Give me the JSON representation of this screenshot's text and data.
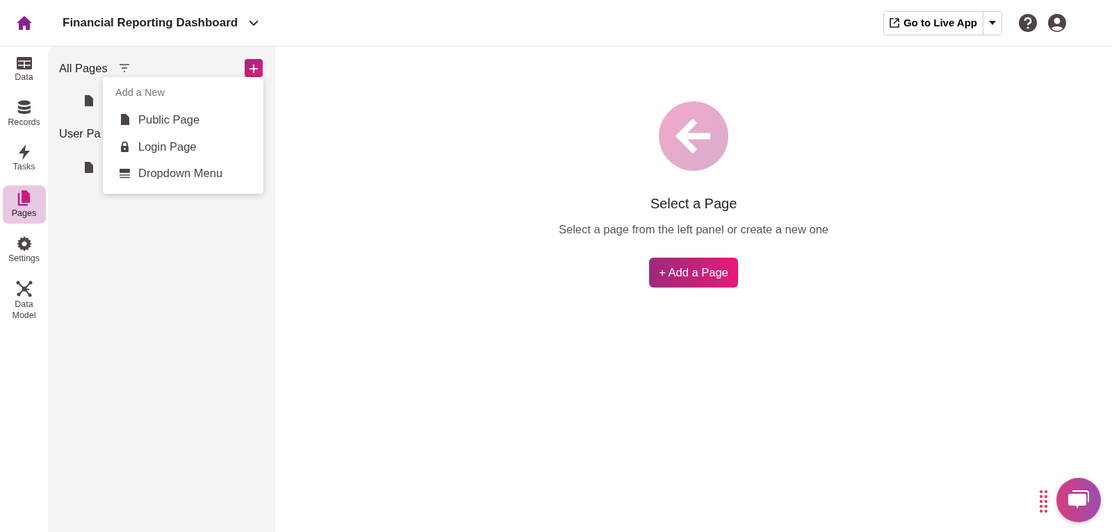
{
  "app": {
    "title": "Financial Reporting Dashboard"
  },
  "header": {
    "live_app_button": "Go to Live App"
  },
  "nav": [
    {
      "label": "Data",
      "kind": "table",
      "selected": false
    },
    {
      "label": "Records",
      "kind": "database",
      "selected": false
    },
    {
      "label": "Tasks",
      "kind": "bolt",
      "selected": false
    },
    {
      "label": "Pages",
      "kind": "pages",
      "selected": true
    },
    {
      "label": "Settings",
      "kind": "gear",
      "selected": false
    },
    {
      "label": "Data Model",
      "kind": "network",
      "selected": false
    }
  ],
  "pages_panel": {
    "title": "All Pages",
    "items": [
      {
        "kind": "page"
      },
      {
        "kind": "heading",
        "label": "User Pa"
      },
      {
        "kind": "page"
      }
    ]
  },
  "add_menu": {
    "heading": "Add a New",
    "items": [
      {
        "label": "Public Page",
        "kind": "file"
      },
      {
        "label": "Login Page",
        "kind": "lock"
      },
      {
        "label": "Dropdown Menu",
        "kind": "menu"
      }
    ]
  },
  "empty_state": {
    "title": "Select a Page",
    "message": "Select a page from the left panel or create a new one",
    "button": "+ Add a Page"
  }
}
